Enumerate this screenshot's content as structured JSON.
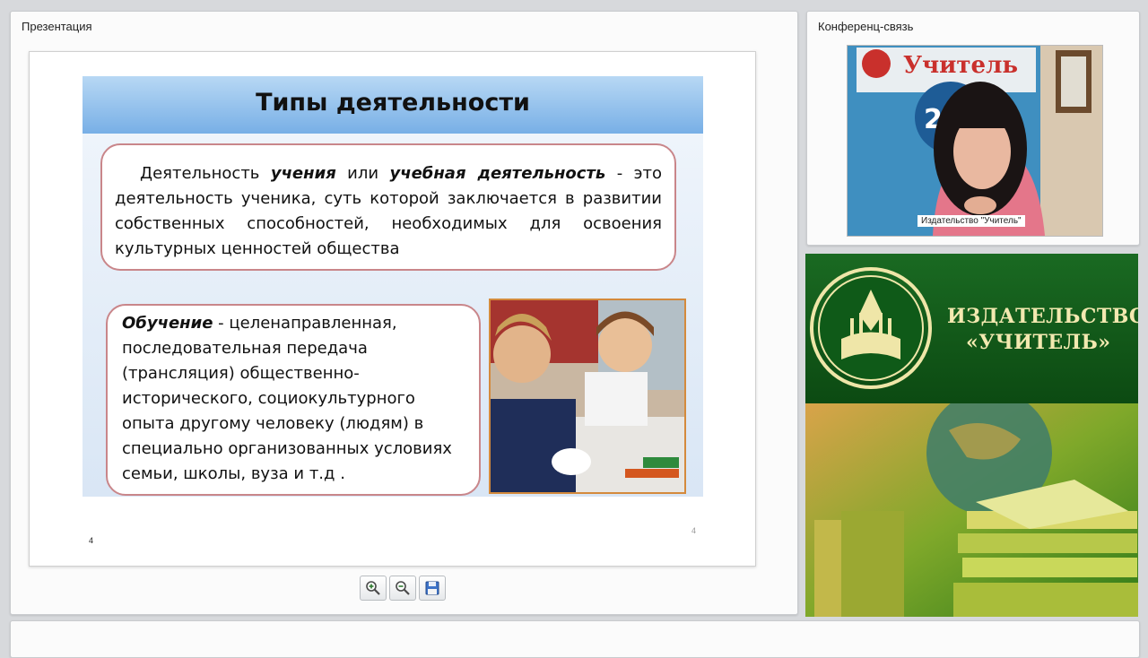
{
  "presentation_panel": {
    "title": "Презентация",
    "slide": {
      "title": "Типы деятельности",
      "box1": {
        "lead": "Деятельность ",
        "term1": "учения",
        "mid": " или ",
        "term2": "учебная деятельность",
        "rest": " - это деятельность ученика, суть которой заключается в развитии собственных способностей, необходимых для освоения культурных ценностей общества"
      },
      "box2": {
        "term": "Обучение",
        "rest": "  - целенаправленная, последовательная передача (трансляция) общественно-исторического, социокультурного опыта другому человеку (людям) в специально организованных условиях семьи, школы, вуза и т.д ."
      },
      "page_number_left": "4",
      "page_number_right": "4"
    },
    "toolbar": {
      "zoom_in_icon": "zoom-in-icon",
      "zoom_out_icon": "zoom-out-icon",
      "save_icon": "save-icon"
    }
  },
  "conference_panel": {
    "title": "Конференц-связь",
    "video_label": "Издательство \"Учитель\""
  },
  "publisher": {
    "name_line1": "ИЗДАТЕЛЬСТВО",
    "name_line2": "«УЧИТЕЛЬ»"
  }
}
